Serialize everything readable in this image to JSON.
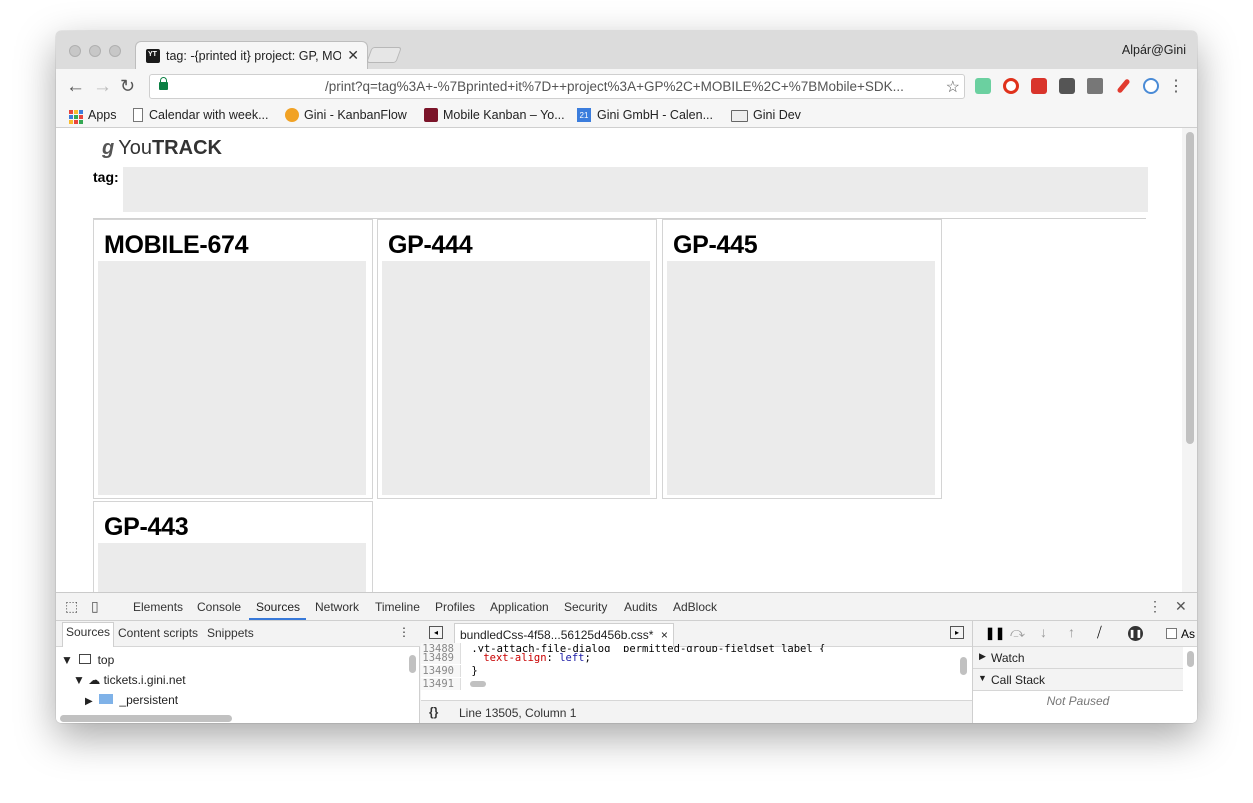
{
  "browser": {
    "tab_title": "tag: -{printed it} project: GP, MOBILE",
    "tab_close": "✕",
    "profile": "Alpár@Gini",
    "url": "/print?q=tag%3A+-%7Bprinted+it%7D++project%3A+GP%2C+MOBILE%2C+%7BMobile+SDK...",
    "bookmarks": [
      "Apps",
      "Calendar with week...",
      "Gini - KanbanFlow",
      "Mobile Kanban – Yo...",
      "Gini GmbH - Calen...",
      "Gini Dev"
    ],
    "calendar_badge": "21"
  },
  "page": {
    "logo_you": "You",
    "logo_track": "TRACK",
    "tag_label": "tag:",
    "cards": [
      "MOBILE-674",
      "GP-444",
      "GP-445",
      "GP-443"
    ]
  },
  "devtools": {
    "tabs": [
      "Elements",
      "Console",
      "Sources",
      "Network",
      "Timeline",
      "Profiles",
      "Application",
      "Security",
      "Audits",
      "AdBlock"
    ],
    "active_tab": "Sources",
    "left_tabs": [
      "Sources",
      "Content scripts",
      "Snippets"
    ],
    "tree": [
      "top",
      "tickets.i.gini.net",
      "_persistent"
    ],
    "file_tab": "bundledCss-4f58...56125d456b.css*",
    "code": [
      {
        "ln": "13488",
        "text": ".yt-attach-file-dialog__permitted-group-fieldset label {"
      },
      {
        "ln": "13489",
        "prop": "text-align",
        "val": "left"
      },
      {
        "ln": "13490",
        "text": "}"
      },
      {
        "ln": "13491",
        "text": ""
      }
    ],
    "format_icon": "{}",
    "cursor_position": "Line 13505, Column 1",
    "watch": "Watch",
    "call_stack": "Call Stack",
    "not_paused": "Not Paused",
    "async_label": "As"
  }
}
